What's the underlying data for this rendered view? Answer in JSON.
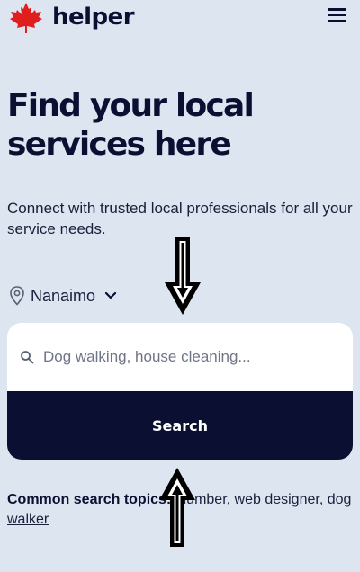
{
  "header": {
    "brand": "helper",
    "logo_icon": "maple-leaf-icon",
    "menu_icon": "hamburger-menu-icon",
    "logo_color": "#e01e1e"
  },
  "hero": {
    "title_line1": "Find your local",
    "title_line2": "services here",
    "subtitle": "Connect with trusted local professionals for all your service needs."
  },
  "location": {
    "icon": "location-pin-icon",
    "city": "Nanaimo",
    "dropdown_icon": "chevron-down-icon"
  },
  "search": {
    "icon": "search-icon",
    "placeholder": "Dog walking, house cleaning...",
    "value": "",
    "button_label": "Search"
  },
  "common_searches": {
    "lead": "Common search topics:",
    "links": [
      "plumber",
      "web designer",
      "dog walker"
    ]
  },
  "annotations": {
    "arrow_down_icon": "arrow-down-icon",
    "arrow_up_icon": "arrow-up-icon"
  },
  "colors": {
    "background": "#dde5f1",
    "navy": "#0b1033",
    "white": "#ffffff"
  }
}
